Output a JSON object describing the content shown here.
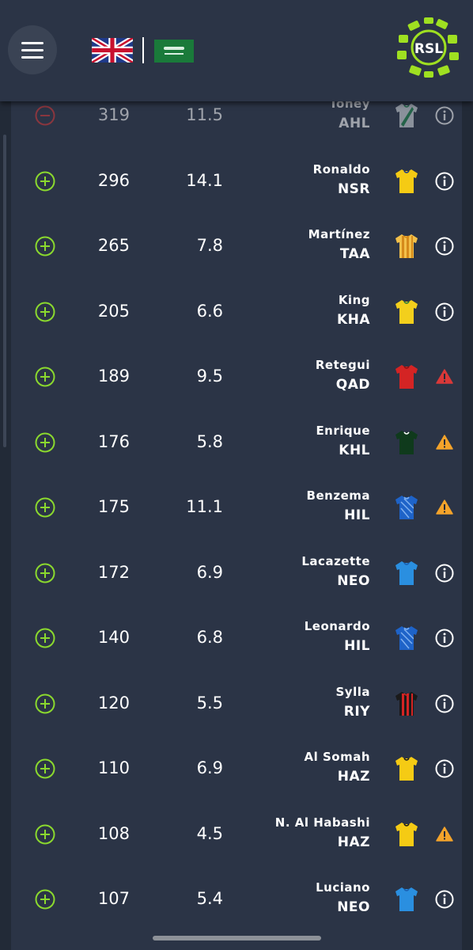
{
  "header": {
    "menu_icon": "hamburger-menu-icon",
    "languages": [
      "English (UK flag)",
      "Arabic (Saudi flag)"
    ],
    "logo_text": "RSL",
    "logo_color": "#9fe021"
  },
  "players": [
    {
      "name": "Toney",
      "team": "AHL",
      "points": "319",
      "value": "11.5",
      "action": "remove",
      "status": "info",
      "kit": {
        "main": "#d9dde2",
        "accent": "#1f8a4c",
        "stripe": "diagonal"
      }
    },
    {
      "name": "Ronaldo",
      "team": "NSR",
      "points": "296",
      "value": "14.1",
      "action": "add",
      "status": "info",
      "kit": {
        "main": "#f5cb14",
        "accent": "#1c3a88",
        "stripe": "none"
      }
    },
    {
      "name": "Martínez",
      "team": "TAA",
      "points": "265",
      "value": "7.8",
      "action": "add",
      "status": "info",
      "kit": {
        "main": "#f3c04a",
        "accent": "#d58a1a",
        "stripe": "vertical"
      }
    },
    {
      "name": "King",
      "team": "KHA",
      "points": "205",
      "value": "6.6",
      "action": "add",
      "status": "info",
      "kit": {
        "main": "#f3cf1c",
        "accent": "#2a7a3a",
        "stripe": "none"
      }
    },
    {
      "name": "Retegui",
      "team": "QAD",
      "points": "189",
      "value": "9.5",
      "action": "add",
      "status": "injury",
      "kit": {
        "main": "#d42424",
        "accent": "#8a1010",
        "stripe": "none"
      }
    },
    {
      "name": "Enrique",
      "team": "KHL",
      "points": "176",
      "value": "5.8",
      "action": "add",
      "status": "doubt",
      "kit": {
        "main": "#0f3a1c",
        "accent": "#ffffff",
        "stripe": "none"
      }
    },
    {
      "name": "Benzema",
      "team": "HIL",
      "points": "175",
      "value": "11.1",
      "action": "add",
      "status": "doubt",
      "kit": {
        "main": "#1e63c8",
        "accent": "#7fb0f0",
        "stripe": "pattern"
      }
    },
    {
      "name": "Lacazette",
      "team": "NEO",
      "points": "172",
      "value": "6.9",
      "action": "add",
      "status": "info",
      "kit": {
        "main": "#2a8fe0",
        "accent": "#1a5fb0",
        "stripe": "none"
      }
    },
    {
      "name": "Leonardo",
      "team": "HIL",
      "points": "140",
      "value": "6.8",
      "action": "add",
      "status": "info",
      "kit": {
        "main": "#1e63c8",
        "accent": "#7fb0f0",
        "stripe": "pattern"
      }
    },
    {
      "name": "Sylla",
      "team": "RIY",
      "points": "120",
      "value": "5.5",
      "action": "add",
      "status": "info",
      "kit": {
        "main": "#1a1a1a",
        "accent": "#d42424",
        "stripe": "vertical"
      }
    },
    {
      "name": "Al Somah",
      "team": "HAZ",
      "points": "110",
      "value": "6.9",
      "action": "add",
      "status": "info",
      "kit": {
        "main": "#f5cb14",
        "accent": "#1a1a1a",
        "stripe": "none"
      }
    },
    {
      "name": "N. Al Habashi",
      "team": "HAZ",
      "points": "108",
      "value": "4.5",
      "action": "add",
      "status": "doubt",
      "kit": {
        "main": "#f5cb14",
        "accent": "#1a1a1a",
        "stripe": "none"
      }
    },
    {
      "name": "Luciano",
      "team": "NEO",
      "points": "107",
      "value": "5.4",
      "action": "add",
      "status": "info",
      "kit": {
        "main": "#2a8fe0",
        "accent": "#1a5fb0",
        "stripe": "none"
      }
    }
  ],
  "colors": {
    "add": "#8bd92e",
    "remove": "#d93838",
    "doubt": "#f4a32a",
    "injury": "#d93838",
    "info": "#ffffff"
  }
}
